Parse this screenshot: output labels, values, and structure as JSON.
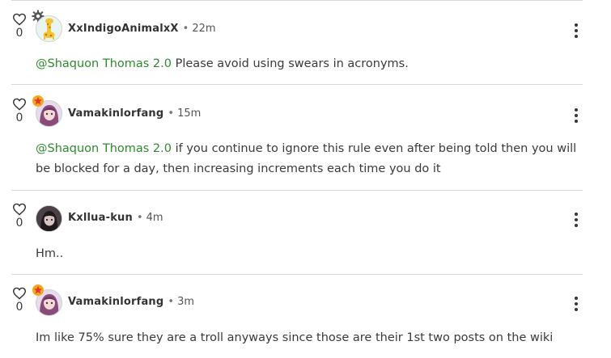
{
  "comments": [
    {
      "likes": "0",
      "username": "XxIndigoAnimalxX",
      "time": "22m",
      "mention": "@Shaquon Thomas 2.0",
      "text": " Please avoid using swears in acronyms.",
      "badge_icon": "gear-icon",
      "avatar_icon": "giraffe-avatar"
    },
    {
      "likes": "0",
      "username": "Vamakinlorfang",
      "time": "15m",
      "mention": "@Shaquon Thomas 2.0",
      "text": " if you continue to ignore this rule even after being told then you will be blocked for a day, then increasing increments each time you do it",
      "badge_icon": "star-badge-icon",
      "avatar_icon": "anime-girl-avatar"
    },
    {
      "likes": "0",
      "username": "Kxllua-kun",
      "time": "4m",
      "mention": "",
      "text": "Hm..",
      "badge_icon": "",
      "avatar_icon": "dark-anime-avatar"
    },
    {
      "likes": "0",
      "username": "Vamakinlorfang",
      "time": "3m",
      "mention": "",
      "text": "Im like 75% sure they are a troll anyways since those are their 1st two posts on the wiki",
      "badge_icon": "star-badge-icon",
      "avatar_icon": "anime-girl-avatar"
    }
  ],
  "colors": {
    "mention": "#2e8a2e",
    "divider": "#d8d8d8",
    "badge_star": "#f5a623"
  },
  "separator": "•"
}
